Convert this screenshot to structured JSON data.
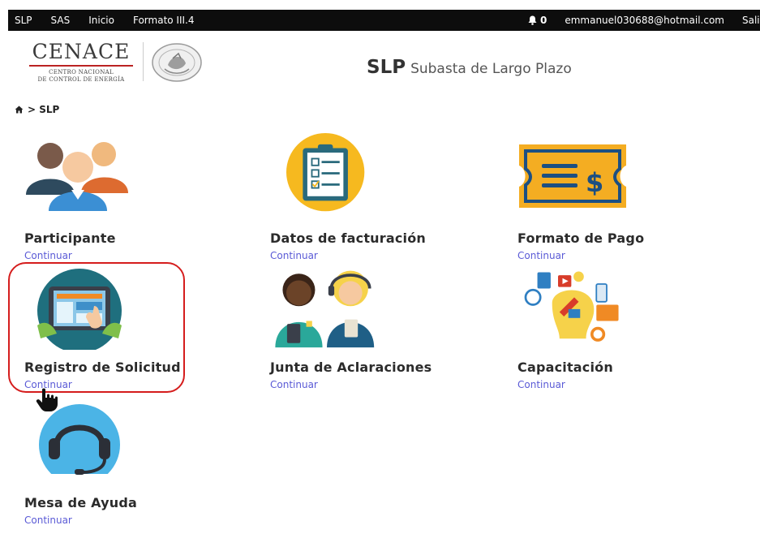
{
  "navbar": {
    "items": [
      "SLP",
      "SAS",
      "Inicio",
      "Formato III.4"
    ],
    "notifications_count": "0",
    "user_email": "emmanuel030688@hotmail.com",
    "logout_label": "Salir"
  },
  "header": {
    "logo_title": "CENACE",
    "logo_subtitle_1": "CENTRO NACIONAL",
    "logo_subtitle_2": "DE CONTROL DE ENERGÍA",
    "page_abbr": "SLP",
    "page_full": "Subasta de Largo Plazo"
  },
  "breadcrumb": {
    "current": "SLP"
  },
  "tiles": [
    {
      "title": "Participante",
      "link": "Continuar"
    },
    {
      "title": "Datos de facturación",
      "link": "Continuar"
    },
    {
      "title": "Formato de Pago",
      "link": "Continuar"
    },
    {
      "title": "Registro de Solicitud",
      "link": "Continuar"
    },
    {
      "title": "Junta de Aclaraciones",
      "link": "Continuar"
    },
    {
      "title": "Capacitación",
      "link": "Continuar"
    },
    {
      "title": "Mesa de Ayuda",
      "link": "Continuar"
    }
  ],
  "colors": {
    "navbar_bg": "#0d0d0d",
    "link": "#5a5ad6",
    "highlight": "#d51d1d",
    "teal": "#1f6f7e",
    "yellow": "#f6b91f",
    "blue": "#2f7fc2"
  },
  "icons": [
    "home-icon",
    "bell-icon",
    "seal-icon",
    "participants-icon",
    "clipboard-icon",
    "ticket-icon",
    "tablet-icon",
    "support-people-icon",
    "training-icon",
    "headset-icon",
    "hand-cursor-icon"
  ]
}
